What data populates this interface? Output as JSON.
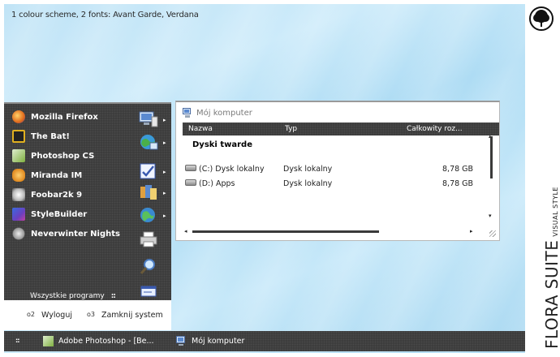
{
  "caption": "1 colour scheme, 2 fonts: Avant Garde, Verdana",
  "branding": {
    "title": "FLORA SUITE",
    "subtitle": "VISUAL STYLE",
    "logo_icon": "tree-logo-icon"
  },
  "start_menu": {
    "programs": [
      {
        "label": "Mozilla Firefox",
        "icon": "firefox-icon",
        "color": "#e06a1a"
      },
      {
        "label": "The Bat!",
        "icon": "bat-icon",
        "color": "#e0b020"
      },
      {
        "label": "Photoshop CS",
        "icon": "photoshop-icon",
        "color": "#7fb040"
      },
      {
        "label": "Miranda IM",
        "icon": "miranda-icon",
        "color": "#e08a20"
      },
      {
        "label": "Foobar2k 9",
        "icon": "foobar-icon",
        "color": "#c0c0c0"
      },
      {
        "label": "StyleBuilder",
        "icon": "stylebuilder-icon",
        "color": "#6a40c0"
      },
      {
        "label": "Neverwinter Nights",
        "icon": "neverwinter-icon",
        "color": "#b0b0b0"
      }
    ],
    "all_programs": "Wszystkie programy",
    "all_programs_dots": "::",
    "right_icons": [
      {
        "icon": "my-computer-icon",
        "has_submenu": true
      },
      {
        "icon": "network-icon",
        "has_submenu": true
      },
      {
        "icon": "control-panel-icon",
        "has_submenu": true
      },
      {
        "icon": "documents-icon",
        "has_submenu": true
      },
      {
        "icon": "internet-icon",
        "has_submenu": true
      },
      {
        "icon": "printer-icon",
        "has_submenu": false
      },
      {
        "icon": "search-icon",
        "has_submenu": false
      },
      {
        "icon": "run-icon",
        "has_submenu": false
      }
    ],
    "logoff_num": "o2",
    "logoff": "Wyloguj",
    "shutdown_num": "o3",
    "shutdown": "Zamknij system",
    "arrow_glyph": "▸"
  },
  "explorer": {
    "title": "Mój komputer",
    "columns": [
      "Nazwa",
      "Typ",
      "Całkowity roz..."
    ],
    "group": "Dyski twarde",
    "rows": [
      {
        "name": "(C:) Dysk lokalny",
        "type": "Dysk lokalny",
        "size": "8,78 GB"
      },
      {
        "name": "(D:) Apps",
        "type": "Dysk lokalny",
        "size": "8,78 GB"
      }
    ],
    "scroll_up": "▴",
    "scroll_down": "▾",
    "scroll_left": "◂",
    "scroll_right": "▸"
  },
  "taskbar": {
    "start": "::",
    "items": [
      {
        "label": "Adobe Photoshop - [Be...",
        "icon": "photoshop-icon"
      },
      {
        "label": "Mój komputer",
        "icon": "my-computer-icon"
      }
    ]
  }
}
